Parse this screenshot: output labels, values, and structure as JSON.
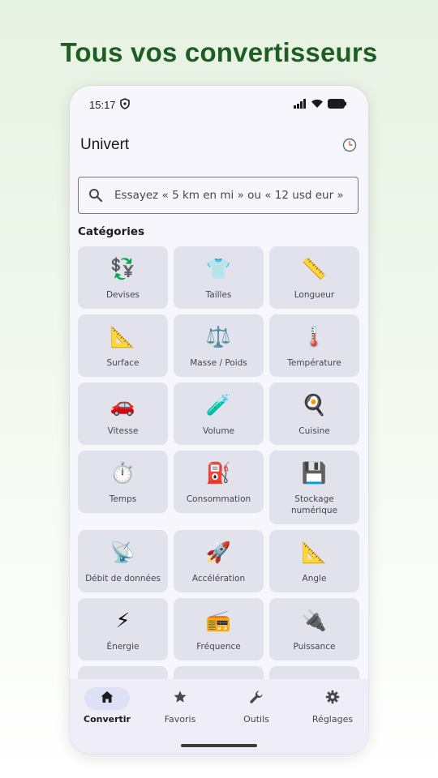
{
  "headline": "Tous vos convertisseurs",
  "status_bar": {
    "time": "15:17"
  },
  "app": {
    "title": "Univert"
  },
  "search": {
    "placeholder": "Essayez « 5 km en mi » ou « 12 usd eur »",
    "value": ""
  },
  "categories": {
    "title": "Catégories",
    "items": [
      {
        "label": "Devises",
        "emoji": "💱"
      },
      {
        "label": "Tailles",
        "emoji": "👕"
      },
      {
        "label": "Longueur",
        "emoji": "📏"
      },
      {
        "label": "Surface",
        "emoji": "📐"
      },
      {
        "label": "Masse / Poids",
        "emoji": "⚖️"
      },
      {
        "label": "Température",
        "emoji": "🌡️"
      },
      {
        "label": "Vitesse",
        "emoji": "🚗"
      },
      {
        "label": "Volume",
        "emoji": "🧪"
      },
      {
        "label": "Cuisine",
        "emoji": "🍳"
      },
      {
        "label": "Temps",
        "emoji": "⏱️"
      },
      {
        "label": "Consommation",
        "emoji": "⛽"
      },
      {
        "label": "Stockage numérique",
        "emoji": "💾"
      },
      {
        "label": "Débit de données",
        "emoji": "📡"
      },
      {
        "label": "Accélération",
        "emoji": "🚀"
      },
      {
        "label": "Angle",
        "emoji": "📐"
      },
      {
        "label": "Énergie",
        "emoji": "⚡"
      },
      {
        "label": "Fréquence",
        "emoji": "📻"
      },
      {
        "label": "Puissance",
        "emoji": "🔌"
      }
    ]
  },
  "nav": {
    "items": [
      {
        "label": "Convertir",
        "icon": "home-icon",
        "active": true
      },
      {
        "label": "Favoris",
        "icon": "star-icon",
        "active": false
      },
      {
        "label": "Outils",
        "icon": "wrench-icon",
        "active": false
      },
      {
        "label": "Réglages",
        "icon": "gear-icon",
        "active": false
      }
    ]
  },
  "colors": {
    "headline": "#1f5e23",
    "tile": "#e2e2ec",
    "nav_active_pill": "#dde1f5"
  }
}
